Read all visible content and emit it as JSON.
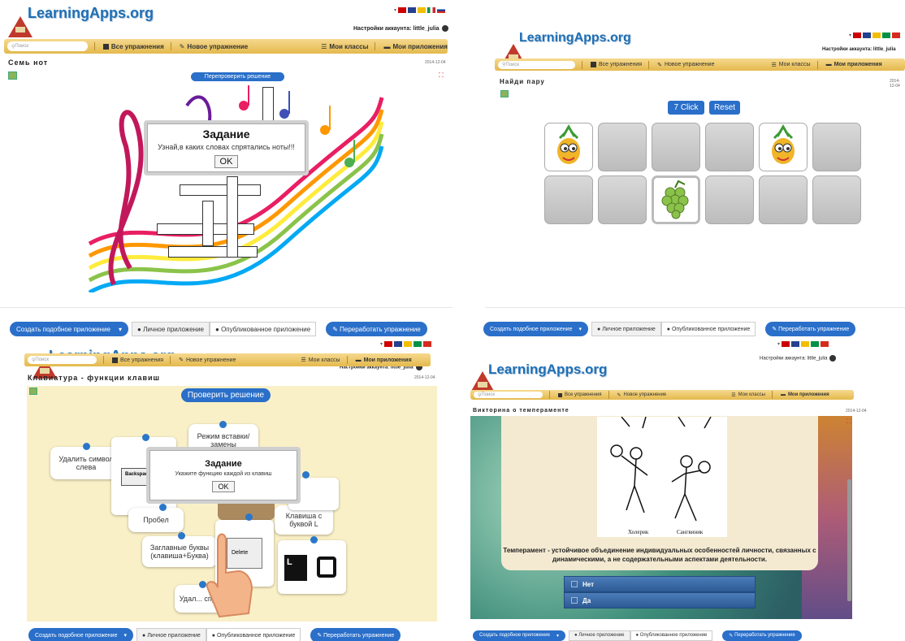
{
  "common": {
    "logo": "LearningApps.org",
    "account": "Настройки аккаунта: little_julia",
    "search_placeholder": "Поиск",
    "nav_all": "Все упражнения",
    "nav_new": "Новое упражнение",
    "nav_classes": "Мои классы",
    "nav_apps": "Мои приложения",
    "btn_create_similar": "Создать подобное приложение",
    "btn_private": "Личное приложение",
    "btn_published": "Опубликованное приложение",
    "btn_rework": "Переработать упражнение",
    "date": "2014-12-04",
    "ok": "OK"
  },
  "panel1": {
    "title": "Семь нот",
    "recheck": "Перепроверить решение",
    "dialog_title": "Задание",
    "dialog_text": "Узнай,в каких словах спрятались ноты!!!"
  },
  "panel2": {
    "title": "Найди пару",
    "click_count": "7 Click",
    "reset": "Reset"
  },
  "panel3": {
    "title": "Клавиатура - функции клавиш",
    "check": "Проверить решение",
    "dialog_title": "Задание",
    "dialog_text": "Укажите функцию каждой из клавиш",
    "cards": [
      "Удалить символ слева",
      "Режим вставки/ замены",
      "Пробел",
      "Заглавные буквы (клавиша+Буква)",
      "Клавиша с буквой L",
      "Удал... спр..."
    ],
    "key_backspace": "Backspace",
    "key_delete": "Delete",
    "key_l": "L"
  },
  "panel4": {
    "title": "Викторина о темпераменте",
    "caption_left": "Холерик",
    "caption_right": "Сангвиник",
    "question": "Темперамент - устойчивое объединение индивидуальных особенностей личности, связанных с динамическими, а не содержательными аспектами деятельности.",
    "answers": [
      "Нет",
      "Да"
    ]
  }
}
